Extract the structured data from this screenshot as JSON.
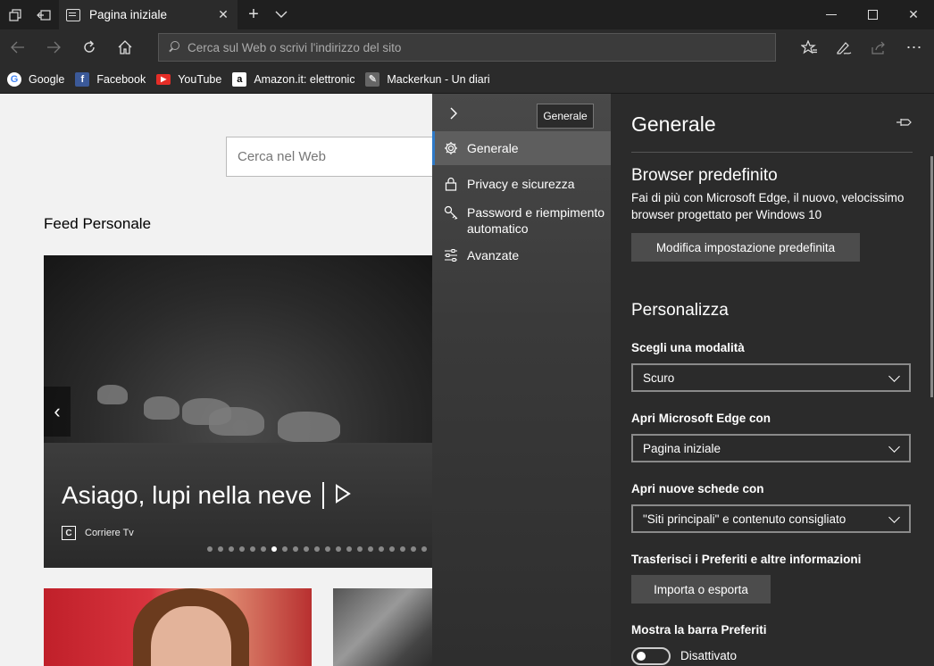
{
  "window": {
    "tab_title": "Pagina iniziale",
    "icons": [
      "tab-set-aside-icon",
      "back-to-tabs-icon",
      "page-icon",
      "close-icon",
      "new-tab-icon",
      "chevron-down-icon",
      "minimize-icon",
      "maximize-icon",
      "window-close-icon"
    ]
  },
  "navbar": {
    "address_placeholder": "Cerca sul Web o scrivi l'indirizzo del sito",
    "icons": [
      "back-icon",
      "forward-icon",
      "refresh-icon",
      "home-icon",
      "favorites-icon",
      "pen-icon",
      "share-icon",
      "more-icon"
    ]
  },
  "favorites": [
    {
      "label": "Google",
      "icon": "google-icon",
      "color": "#4285f4"
    },
    {
      "label": "Facebook",
      "icon": "facebook-icon",
      "color": "#3b5998"
    },
    {
      "label": "YouTube",
      "icon": "youtube-icon",
      "color": "#e52d27"
    },
    {
      "label": "Amazon.it: elettronica",
      "icon": "amazon-icon",
      "color": "#ffffff"
    },
    {
      "label": "Mackerkun - Un diari",
      "icon": "mackerkun-icon",
      "color": "#666666"
    }
  ],
  "page": {
    "search_placeholder": "Cerca nel Web",
    "feed_title": "Feed Personale",
    "hero": {
      "headline": "Asiago, lupi nella neve",
      "source": "Corriere Tv",
      "slide_count": 21,
      "active_slide": 7
    }
  },
  "settings_nav": {
    "tooltip": "Generale",
    "items": [
      {
        "label": "Generale",
        "icon": "gear-icon",
        "selected": true
      },
      {
        "label": "Privacy e sicurezza",
        "icon": "lock-icon",
        "selected": false
      },
      {
        "label": "Password e riempimento automatico",
        "icon": "key-icon",
        "selected": false
      },
      {
        "label": "Avanzate",
        "icon": "sliders-icon",
        "selected": false
      }
    ]
  },
  "settings": {
    "title": "Generale",
    "default_browser": {
      "heading": "Browser predefinito",
      "description": "Fai di più con Microsoft Edge, il nuovo, velocissimo browser progettato per Windows 10",
      "button": "Modifica impostazione predefinita"
    },
    "personalize": {
      "heading": "Personalizza",
      "mode_label": "Scegli una modalità",
      "mode_value": "Scuro",
      "open_with_label": "Apri Microsoft Edge con",
      "open_with_value": "Pagina iniziale",
      "new_tabs_label": "Apri nuove schede con",
      "new_tabs_value": "\"Siti principali\" e contenuto consigliato",
      "transfer_label": "Trasferisci i Preferiti e altre informazioni",
      "transfer_button": "Importa o esporta",
      "favbar_label": "Mostra la barra Preferiti",
      "favbar_state": "Disattivato"
    }
  },
  "colors": {
    "accent": "#2e79c7",
    "settings_bg": "#2b2b2b",
    "page_bg": "#f2f2f2"
  }
}
